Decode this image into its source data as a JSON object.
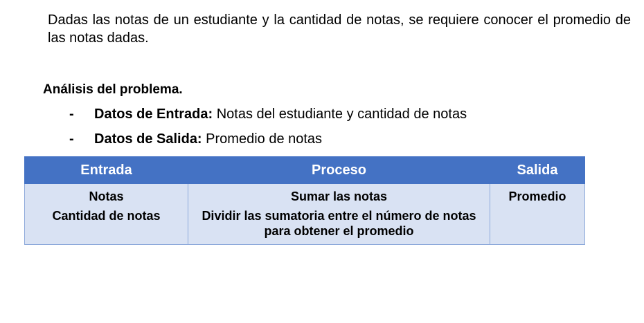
{
  "intro": {
    "text": "Dadas las notas de un estudiante y la cantidad de notas, se requiere conocer el promedio de las notas dadas."
  },
  "analysis": {
    "title": "Análisis del problema.",
    "items": [
      {
        "dash": "-",
        "label": "Datos de Entrada:",
        "value": " Notas del estudiante y cantidad de notas"
      },
      {
        "dash": "-",
        "label": "Datos de Salida:",
        "value": " Promedio de notas"
      }
    ]
  },
  "ipo_table": {
    "header_color": "#4472c4",
    "body_color": "#d9e2f3",
    "headers": {
      "entrada": "Entrada",
      "proceso": "Proceso",
      "salida": "Salida"
    },
    "entrada": [
      "Notas",
      "Cantidad de notas"
    ],
    "proceso": [
      "Sumar las notas",
      "Dividir las sumatoria entre el número de notas para obtener el promedio"
    ],
    "salida": [
      "Promedio"
    ]
  }
}
